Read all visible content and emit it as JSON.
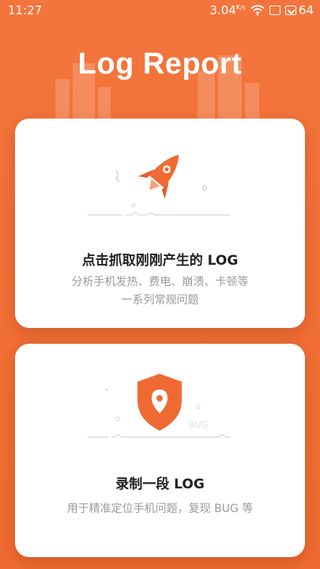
{
  "status_bar": {
    "time": "11:27",
    "speed": "3.04",
    "speed_unit": "K/s",
    "battery": "64"
  },
  "title": "Log Report",
  "cards": [
    {
      "title": "点击抓取刚刚产生的 LOG",
      "description_line1": "分析手机发热、费电、崩溃、卡顿等",
      "description_line2": "一系列常规问题",
      "icon": "rocket-icon"
    },
    {
      "title": "录制一段 LOG",
      "description_line1": "用于精准定位手机问题，复现 BUG 等",
      "illustration_text": "BUG",
      "icon": "shield-location-icon"
    }
  ],
  "colors": {
    "accent": "#f2703a",
    "card_bg": "#ffffff",
    "title_text": "#222222",
    "desc_text": "#9a9a9a"
  }
}
